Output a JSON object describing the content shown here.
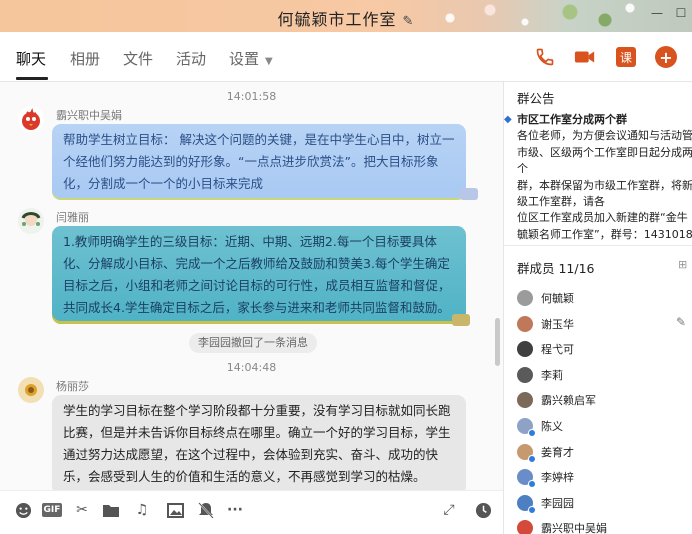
{
  "window": {
    "title": "何毓颖市工作室",
    "controls": [
      "minimize",
      "maximize"
    ]
  },
  "tabs": [
    {
      "label": "聊天",
      "active": true
    },
    {
      "label": "相册",
      "active": false
    },
    {
      "label": "文件",
      "active": false
    },
    {
      "label": "活动",
      "active": false
    },
    {
      "label": "设置",
      "active": false
    }
  ],
  "toolbar": {
    "call_icon": "phone-icon",
    "video_icon": "video-camera-icon",
    "class_label": "课",
    "add_label": "+"
  },
  "chat": {
    "messages": [
      {
        "time": "14:01:58",
        "sender": "霸兴职中吴娟",
        "text": "帮助学生树立目标： 解决这个问题的关键，是在中学生心目中，树立一个经他们努力能达到的好形象。“一点点进步欣赏法”。把大目标形象化，分割成一个一个的小目标来完成"
      },
      {
        "sender": "闫雅丽",
        "text": "1.教师明确学生的三级目标：近期、中期、远期2.每一个目标要具体化、分解成小目标、完成一个之后教师给及鼓励和赞美3.每个学生确定目标之后，小组和老师之间讨论目标的可行性，成员相互监督和督促，共同成长4.学生确定目标之后，家长参与进来和老师共同监督和鼓励。"
      },
      {
        "recall_notice": "李园园撤回了一条消息"
      },
      {
        "time": "14:04:48",
        "sender": "杨丽莎",
        "text": "学生的学习目标在整个学习阶段都十分重要，没有学习目标就如同长跑比赛，但是并未告诉你目标终点在哪里。确立一个好的学习目标，学生通过努力达成愿望，在这个过程中，会体验到充实、奋斗、成功的快乐，会感受到人生的价值和生活的意义，不再感觉到学习的枯燥。"
      }
    ]
  },
  "input_toolbar": {
    "icons": [
      "emoji-icon",
      "gif-icon",
      "scissors-icon",
      "folder-icon",
      "music-note-icon",
      "image-icon",
      "mute-bell-icon",
      "more-icon"
    ],
    "gif_label": "GIF",
    "more_label": "···",
    "right_icons": [
      "expand-icon",
      "history-clock-icon"
    ]
  },
  "notice": {
    "header": "群公告",
    "title": "市区工作室分成两个群",
    "lines": [
      "各位老师，为方便会议通知与活动管",
      "市级、区级两个工作室即日起分成两个",
      "群，本群保留为市级工作室群，将新",
      "级工作室群，请各",
      "位区工作室成员加入新建的群“金牛",
      "毓颖名师工作室”，群号：1431018"
    ]
  },
  "members": {
    "header": "群成员 11/16",
    "list": [
      {
        "name": "何毓颖",
        "color": "#9b9b9b",
        "badge": false
      },
      {
        "name": "谢玉华",
        "color": "#c0785a",
        "badge": false
      },
      {
        "name": "程弋可",
        "color": "#3f3f3f",
        "badge": false
      },
      {
        "name": "李莉",
        "color": "#5a5a5a",
        "badge": false
      },
      {
        "name": "霸兴赖启军",
        "color": "#7b6a5a",
        "badge": false
      },
      {
        "name": "陈义",
        "color": "#8ea2c6",
        "badge": true
      },
      {
        "name": "姜育才",
        "color": "#c69a6e",
        "badge": true
      },
      {
        "name": "李婷梓",
        "color": "#6a8cc8",
        "badge": true
      },
      {
        "name": "李园园",
        "color": "#4d7fc2",
        "badge": true
      },
      {
        "name": "霸兴职中吴娟",
        "color": "#d44a3a",
        "badge": false
      }
    ]
  }
}
